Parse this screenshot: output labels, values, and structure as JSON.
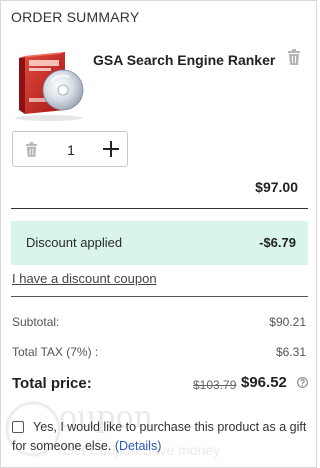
{
  "header": {
    "title": "ORDER SUMMARY"
  },
  "product": {
    "name": "GSA Search Engine Ranker",
    "image_icon": "product-box-icon",
    "quantity": "1",
    "line_price": "$97.00"
  },
  "discount": {
    "label": "Discount applied",
    "value": "-$6.79"
  },
  "coupon": {
    "link_text": "I have a discount coupon"
  },
  "summary": {
    "subtotal_label": "Subtotal:",
    "subtotal_value": "$90.21",
    "tax_label": "Total TAX (7%) :",
    "tax_value": "$6.31",
    "total_label": "Total price:",
    "total_old": "$103.79",
    "total_new": "$96.52"
  },
  "gift": {
    "text": "Yes, I would like to purchase this product as a gift for someone else.",
    "details_link": "(Details)",
    "checked": false
  },
  "watermark": {
    "top": "oupon",
    "bottom": "Get Coupon Save money"
  },
  "colors": {
    "discount_bg": "#d9f5ea",
    "link_blue": "#2a59b8",
    "border": "#d9d9d9"
  }
}
